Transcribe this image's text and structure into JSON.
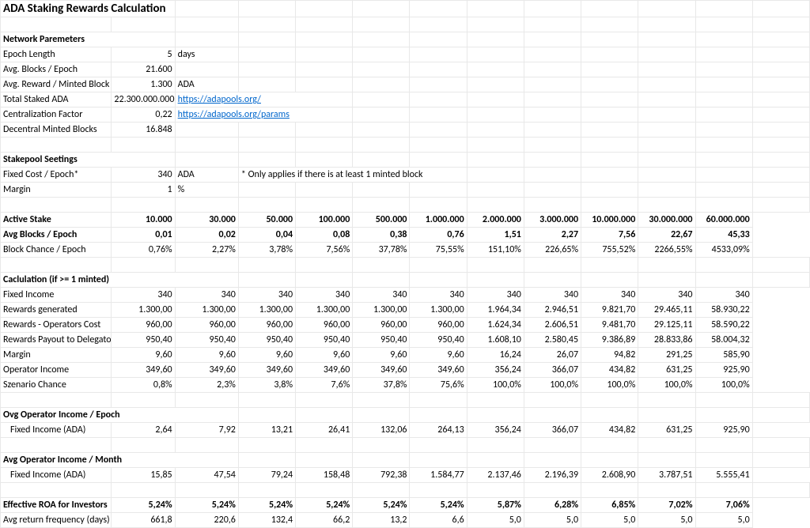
{
  "title": "ADA Staking Rewards Calculation",
  "sections": {
    "netparams": {
      "header": "Network Paremeters",
      "rows": {
        "epoch_length": {
          "label": "Epoch Length",
          "value": "5",
          "unit": "days"
        },
        "avg_blocks": {
          "label": "Avg. Blocks / Epoch",
          "value": "21.600",
          "unit": ""
        },
        "avg_reward": {
          "label": "Avg. Reward / Minted Block",
          "value": "1.300",
          "unit": "ADA"
        },
        "total_staked": {
          "label": "Total Staked ADA",
          "value": "22.300.000.000",
          "link": "https://adapools.org/"
        },
        "central_factor": {
          "label": "Centralization Factor",
          "value": "0,22",
          "link": "https://adapools.org/params"
        },
        "dec_minted": {
          "label": "Decentral Minted Blocks",
          "value": "16.848",
          "unit": ""
        }
      }
    },
    "pool": {
      "header": "Stakepool Seetings",
      "rows": {
        "fixed_cost": {
          "label": "Fixed Cost / Epoch*",
          "value": "340",
          "unit": "ADA",
          "note": "* Only applies if there is at least 1 minted block"
        },
        "margin": {
          "label": "Margin",
          "value": "1",
          "unit": "%"
        }
      }
    },
    "active_stake_label": "Active Stake",
    "avg_blocks_label": "Avg Blocks / Epoch",
    "block_chance_label": "Block Chance / Epoch",
    "calc_header": "Caclulation (if >= 1 minted)",
    "calc_rows": {
      "fixed_income": "Fixed Income",
      "rewards_generated": "Rewards generated",
      "rewards_op_cost": "Rewards - Operators Cost",
      "rewards_payout": "Rewards Payout to Delegators",
      "margin": "Margin",
      "operator_income": "Operator Income",
      "scenario_chance": "Szenario Chance"
    },
    "ovg_header": "Ovg Operator Income / Epoch",
    "ovg_sub": "Fixed Income (ADA)",
    "avg_month_header": "Avg Operator Income / Month",
    "avg_month_sub": "Fixed Income (ADA)",
    "roa_header": "Effective ROA for Investors",
    "freq_label": "Avg return frequency (days)"
  },
  "chart_data": {
    "type": "table",
    "columns": [
      "10.000",
      "30.000",
      "50.000",
      "100.000",
      "500.000",
      "1.000.000",
      "2.000.000",
      "3.000.000",
      "10.000.000",
      "30.000.000",
      "60.000.000"
    ],
    "rows": {
      "avg_blocks": [
        "0,01",
        "0,02",
        "0,04",
        "0,08",
        "0,38",
        "0,76",
        "1,51",
        "2,27",
        "7,56",
        "22,67",
        "45,33"
      ],
      "block_chance": [
        "0,76%",
        "2,27%",
        "3,78%",
        "7,56%",
        "37,78%",
        "75,55%",
        "151,10%",
        "226,65%",
        "755,52%",
        "2266,55%",
        "4533,09%"
      ],
      "fixed_income": [
        "340",
        "340",
        "340",
        "340",
        "340",
        "340",
        "340",
        "340",
        "340",
        "340",
        "340"
      ],
      "rewards_generated": [
        "1.300,00",
        "1.300,00",
        "1.300,00",
        "1.300,00",
        "1.300,00",
        "1.300,00",
        "1.964,34",
        "2.946,51",
        "9.821,70",
        "29.465,11",
        "58.930,22"
      ],
      "rewards_op_cost": [
        "960,00",
        "960,00",
        "960,00",
        "960,00",
        "960,00",
        "960,00",
        "1.624,34",
        "2.606,51",
        "9.481,70",
        "29.125,11",
        "58.590,22"
      ],
      "rewards_payout": [
        "950,40",
        "950,40",
        "950,40",
        "950,40",
        "950,40",
        "950,40",
        "1.608,10",
        "2.580,45",
        "9.386,89",
        "28.833,86",
        "58.004,32"
      ],
      "margin": [
        "9,60",
        "9,60",
        "9,60",
        "9,60",
        "9,60",
        "9,60",
        "16,24",
        "26,07",
        "94,82",
        "291,25",
        "585,90"
      ],
      "operator_income": [
        "349,60",
        "349,60",
        "349,60",
        "349,60",
        "349,60",
        "349,60",
        "356,24",
        "366,07",
        "434,82",
        "631,25",
        "925,90"
      ],
      "scenario_chance": [
        "0,8%",
        "2,3%",
        "3,8%",
        "7,6%",
        "37,8%",
        "75,6%",
        "100,0%",
        "100,0%",
        "100,0%",
        "100,0%",
        "100,0%"
      ],
      "ovg_epoch": [
        "2,64",
        "7,92",
        "13,21",
        "26,41",
        "132,06",
        "264,13",
        "356,24",
        "366,07",
        "434,82",
        "631,25",
        "925,90"
      ],
      "avg_month": [
        "15,85",
        "47,54",
        "79,24",
        "158,48",
        "792,38",
        "1.584,77",
        "2.137,46",
        "2.196,39",
        "2.608,90",
        "3.787,51",
        "5.555,41"
      ],
      "roa": [
        "5,24%",
        "5,24%",
        "5,24%",
        "5,24%",
        "5,24%",
        "5,24%",
        "5,87%",
        "6,28%",
        "6,85%",
        "7,02%",
        "7,06%"
      ],
      "freq": [
        "661,8",
        "220,6",
        "132,4",
        "66,2",
        "13,2",
        "6,6",
        "5,0",
        "5,0",
        "5,0",
        "5,0",
        "5,0"
      ]
    }
  }
}
